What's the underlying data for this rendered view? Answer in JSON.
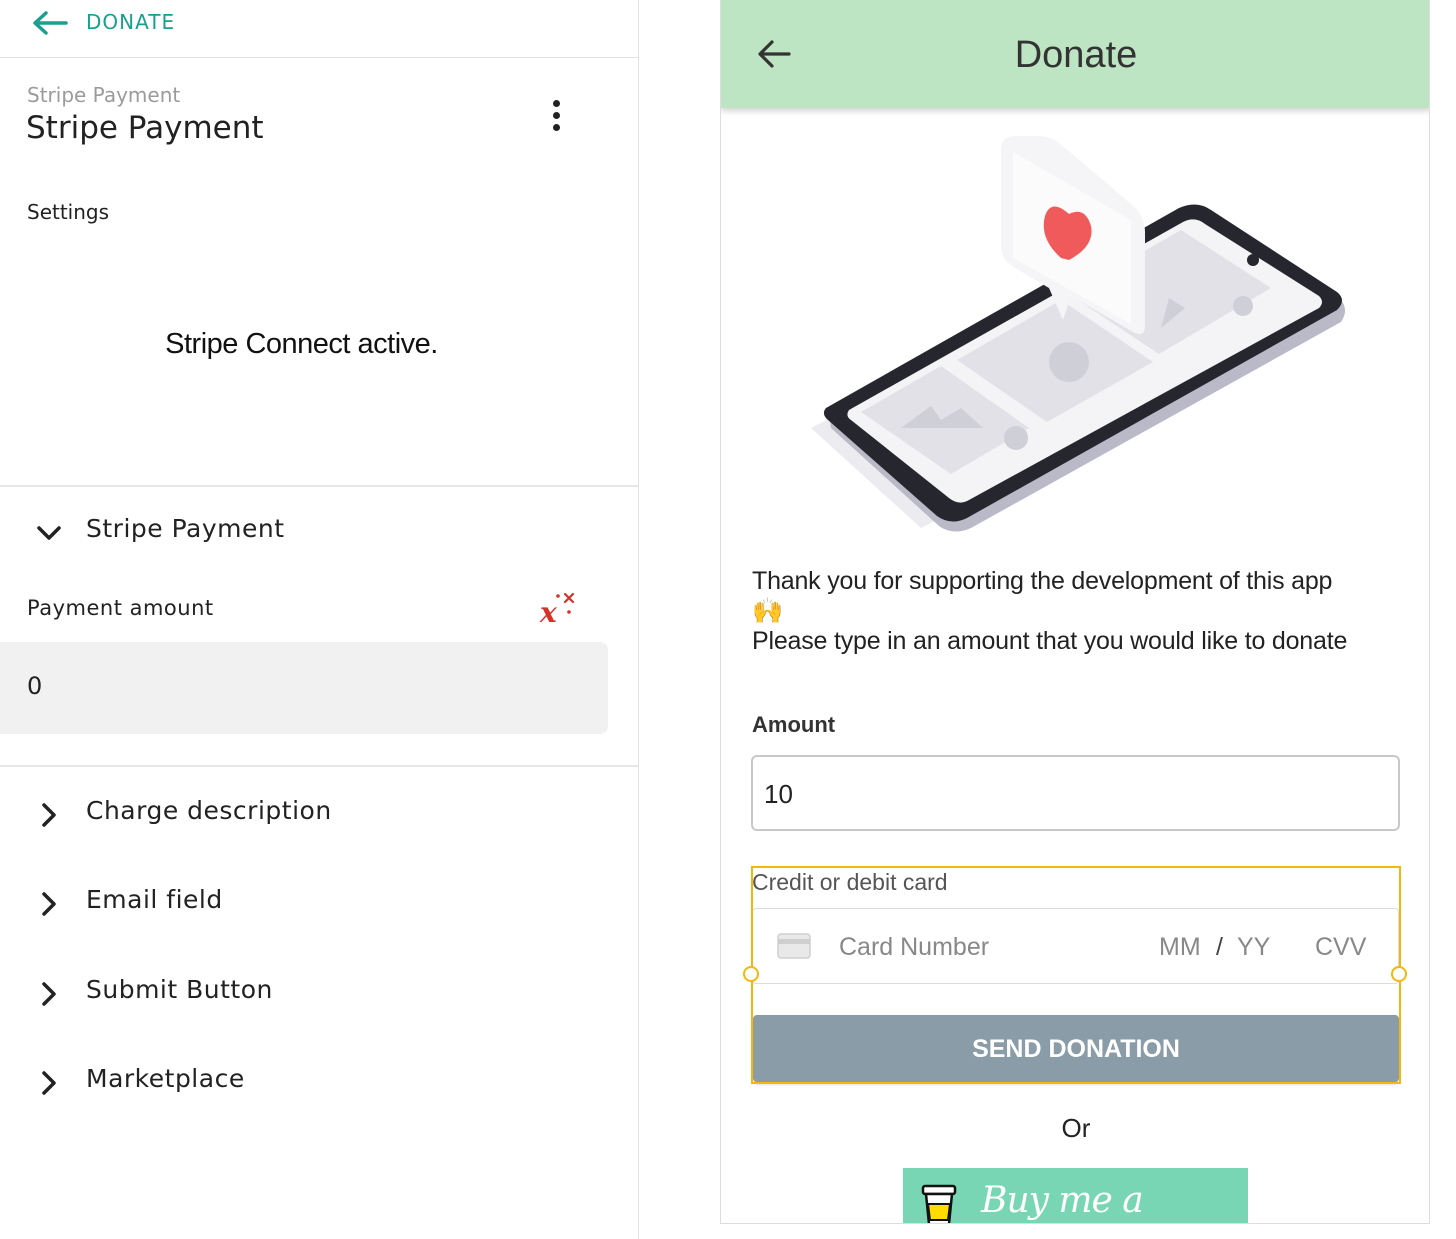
{
  "editor": {
    "back_label": "DONATE",
    "subtitle": "Stripe Payment",
    "title": "Stripe Payment",
    "settings_label": "Settings",
    "connect_status": "Stripe Connect active.",
    "expanded_section": "Stripe Payment",
    "payment_amount_label": "Payment amount",
    "payment_amount_value": "0",
    "sections": [
      {
        "label": "Charge description",
        "icon": "chevron-right-icon"
      },
      {
        "label": "Email field",
        "icon": "chevron-right-icon"
      },
      {
        "label": "Submit Button",
        "icon": "chevron-right-icon"
      },
      {
        "label": "Marketplace",
        "icon": "chevron-right-icon"
      }
    ],
    "accent_color": "#1aa08e"
  },
  "preview": {
    "appbar_title": "Donate",
    "appbar_color": "#bde4c3",
    "message_line1": "Thank you for supporting the development of this app",
    "message_emoji": "🙌",
    "message_line2": "Please type in an amount that you would like to donate",
    "amount_label": "Amount",
    "amount_value": "10",
    "card_label": "Credit or debit card",
    "card_number_placeholder": "Card Number",
    "card_mm_placeholder": "MM",
    "card_slash": "/",
    "card_yy_placeholder": "YY",
    "card_cvv_placeholder": "CVV",
    "send_button": "SEND DONATION",
    "or_text": "Or",
    "bmc_text": "Buy me a coffee",
    "button_color": "#8a9ca7",
    "selection_color": "#f2b80f"
  }
}
